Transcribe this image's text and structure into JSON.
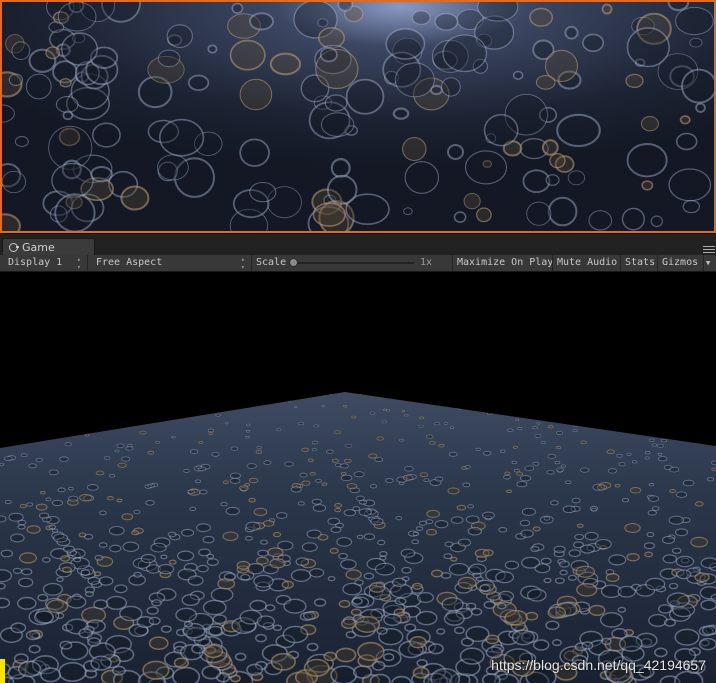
{
  "scene_view": {
    "border_color": "#e26b1f",
    "surface_color": "#1c2535",
    "highlight_color": "#6b7ea8"
  },
  "game_tab": {
    "label": "Game",
    "icon": "pacman-icon"
  },
  "toolbar": {
    "display": "Display 1",
    "aspect": "Free Aspect",
    "scale_label": "Scale",
    "scale_value": "1x",
    "maximize": "Maximize On Play",
    "mute": "Mute Audio",
    "stats": "Stats",
    "gizmos": "Gizmos"
  },
  "game_view": {
    "background": "#000000",
    "surface_color": "#2a3649"
  },
  "watermark": "https://blog.csdn.net/qq_42194657"
}
